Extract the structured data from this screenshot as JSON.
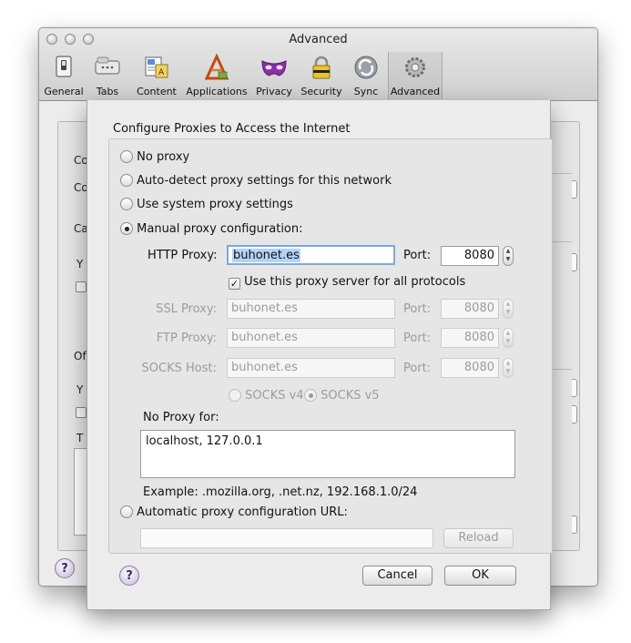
{
  "window": {
    "title": "Advanced",
    "toolbar": [
      {
        "label": "General",
        "icon": "switch-icon"
      },
      {
        "label": "Tabs",
        "icon": "tabs-icon"
      },
      {
        "label": "Content",
        "icon": "content-icon"
      },
      {
        "label": "Applications",
        "icon": "applications-icon"
      },
      {
        "label": "Privacy",
        "icon": "privacy-mask-icon"
      },
      {
        "label": "Security",
        "icon": "padlock-icon"
      },
      {
        "label": "Sync",
        "icon": "sync-icon"
      },
      {
        "label": "Advanced",
        "icon": "gear-icon"
      }
    ],
    "selected_tab": "Advanced",
    "background_fragments": [
      "Co",
      "Co",
      "Ca",
      "Y",
      "Of",
      "Y",
      "T"
    ]
  },
  "sheet": {
    "heading": "Configure Proxies to Access the Internet",
    "options": {
      "no_proxy": "No proxy",
      "auto_detect": "Auto-detect proxy settings for this network",
      "system": "Use system proxy settings",
      "manual": "Manual proxy configuration:",
      "auto_url": "Automatic proxy configuration URL:"
    },
    "selected_option": "manual",
    "http_label": "HTTP Proxy:",
    "http_value": "buhonet.es",
    "http_port": "8080",
    "port_label": "Port:",
    "use_all_label": "Use this proxy server for all protocols",
    "use_all_checked": true,
    "ssl_label": "SSL Proxy:",
    "ssl_value": "buhonet.es",
    "ssl_port": "8080",
    "ftp_label": "FTP Proxy:",
    "ftp_value": "buhonet.es",
    "ftp_port": "8080",
    "socks_label": "SOCKS Host:",
    "socks_value": "buhonet.es",
    "socks_port": "8080",
    "socks_v4": "SOCKS v4",
    "socks_v5": "SOCKS v5",
    "socks_selected": "SOCKS v5",
    "no_proxy_label": "No Proxy for:",
    "no_proxy_value": "localhost, 127.0.0.1",
    "example": "Example: .mozilla.org, .net.nz, 192.168.1.0/24",
    "auto_url_value": "",
    "reload_label": "Reload",
    "cancel_label": "Cancel",
    "ok_label": "OK",
    "help_label": "?"
  }
}
